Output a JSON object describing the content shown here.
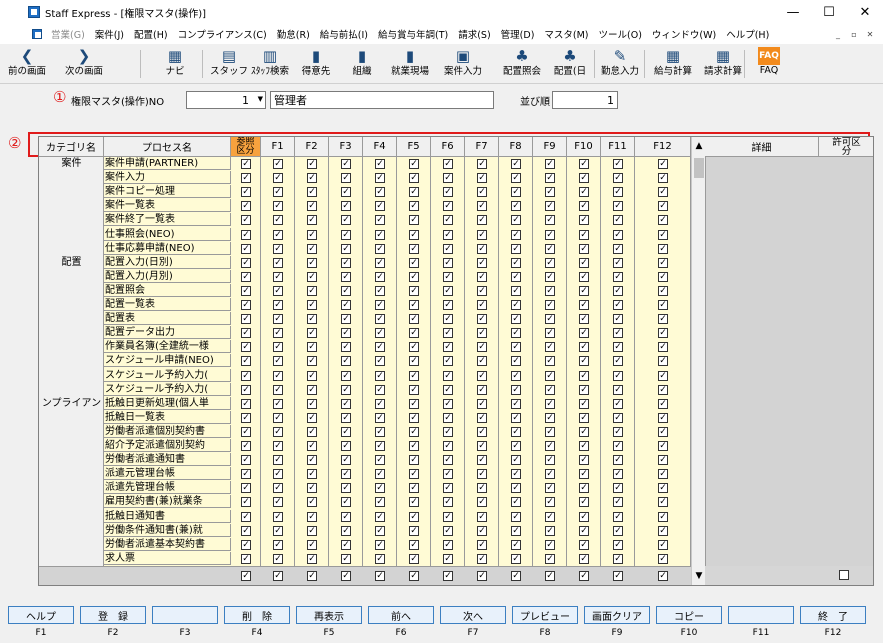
{
  "window": {
    "title": "Staff Express - [権限マスタ(操作)]",
    "minimize": "—",
    "maximize": "☐",
    "close": "✕"
  },
  "menu": [
    {
      "label": "営業(G)",
      "disabled": true
    },
    {
      "label": "案件(J)"
    },
    {
      "label": "配置(H)"
    },
    {
      "label": "コンプライアンス(C)"
    },
    {
      "label": "勤怠(R)"
    },
    {
      "label": "給与前払(I)"
    },
    {
      "label": "給与賞与年調(T)"
    },
    {
      "label": "請求(S)"
    },
    {
      "label": "管理(D)"
    },
    {
      "label": "マスタ(M)"
    },
    {
      "label": "ツール(O)"
    },
    {
      "label": "ウィンドウ(W)"
    },
    {
      "label": "ヘルプ(H)"
    }
  ],
  "mdi": [
    "_",
    "▫",
    "✕"
  ],
  "toolbar": [
    {
      "label": "前の画面",
      "icon": "back-arrow-icon",
      "glyph": "❮"
    },
    {
      "label": "次の画面",
      "icon": "forward-arrow-icon",
      "glyph": "❯"
    },
    {
      "label": "ナビ",
      "icon": "navi-icon",
      "glyph": "▦"
    },
    {
      "label": "スタッフ",
      "icon": "staff-icon",
      "glyph": "▤"
    },
    {
      "label": "ｽﾀｯﾌ検索",
      "icon": "staff-search-icon",
      "glyph": "▥"
    },
    {
      "label": "得意先",
      "icon": "customer-icon",
      "glyph": "▮"
    },
    {
      "label": "組織",
      "icon": "organization-icon",
      "glyph": "▮"
    },
    {
      "label": "就業現場",
      "icon": "worksite-icon",
      "glyph": "▮"
    },
    {
      "label": "案件入力",
      "icon": "case-entry-icon",
      "glyph": "▣"
    },
    {
      "label": "配置照会",
      "icon": "placement-inquiry-icon",
      "glyph": "♣"
    },
    {
      "label": "配置(日",
      "icon": "placement-day-icon",
      "glyph": "♣"
    },
    {
      "label": "勤怠入力",
      "icon": "attendance-entry-icon",
      "glyph": "✎"
    },
    {
      "label": "給与計算",
      "icon": "payroll-icon",
      "glyph": "▦"
    },
    {
      "label": "請求計算",
      "icon": "billing-icon",
      "glyph": "▦"
    },
    {
      "label": "FAQ",
      "icon": "faq-icon",
      "glyph": "FAQ"
    }
  ],
  "form": {
    "marker1": "①",
    "marker2": "②",
    "no_label": "権限マスタ(操作)NO",
    "no_value": "1",
    "name_value": "管理者",
    "order_label": "並び順",
    "order_value": "1"
  },
  "grid": {
    "headers": {
      "category": "カテゴリ名",
      "process": "プロセス名",
      "ref_line1": "参照",
      "ref_line2": "区分",
      "detail": "詳細",
      "permit_line1": "許可区",
      "permit_line2": "分"
    },
    "fcols": [
      "F1",
      "F2",
      "F3",
      "F4",
      "F5",
      "F6",
      "F7",
      "F8",
      "F9",
      "F10",
      "F11",
      "F12"
    ],
    "checked": "✓",
    "categories": [
      {
        "label": "案件",
        "row": 0
      },
      {
        "label": "配置",
        "row": 7
      },
      {
        "label": "ンプライアン",
        "row": 17
      }
    ],
    "rows": [
      "案件申請(PARTNER)",
      "案件入力",
      "案件コピー処理",
      "案件一覧表",
      "案件終了一覧表",
      "仕事照会(NEO)",
      "仕事応募申請(NEO)",
      "配置入力(日別)",
      "配置入力(月別)",
      "配置照会",
      "配置一覧表",
      "配置表",
      "配置データ出力",
      "作業員名簿(全建統一様",
      "スケジュール申請(NEO)",
      "スケジュール予約入力(",
      "スケジュール予約入力(",
      "抵触日更新処理(個人単",
      "抵触日一覧表",
      "労働者派遣個別契約書",
      "紹介予定派遣個別契約",
      "労働者派遣通知書",
      "派遣元管理台帳",
      "派遣先管理台帳",
      "雇用契約書(兼)就業条",
      "抵触日通知書",
      "労働条件通知書(兼)就",
      "労働者派遣基本契約書",
      "求人票"
    ]
  },
  "fkeys": [
    {
      "label": "ヘルプ",
      "key": "F1"
    },
    {
      "label": "登　録",
      "key": "F2"
    },
    {
      "label": "",
      "key": "F3"
    },
    {
      "label": "削　除",
      "key": "F4"
    },
    {
      "label": "再表示",
      "key": "F5"
    },
    {
      "label": "前へ",
      "key": "F6"
    },
    {
      "label": "次へ",
      "key": "F7"
    },
    {
      "label": "プレビュー",
      "key": "F8"
    },
    {
      "label": "画面クリア",
      "key": "F9"
    },
    {
      "label": "コピー",
      "key": "F10"
    },
    {
      "label": "",
      "key": "F11"
    },
    {
      "label": "終　了",
      "key": "F12"
    }
  ],
  "colors": {
    "accent_red": "#e01b1b",
    "header_orange": "#f7a23e",
    "row_yellow": "#fffbd5",
    "fkey_border": "#3c7fc1"
  }
}
